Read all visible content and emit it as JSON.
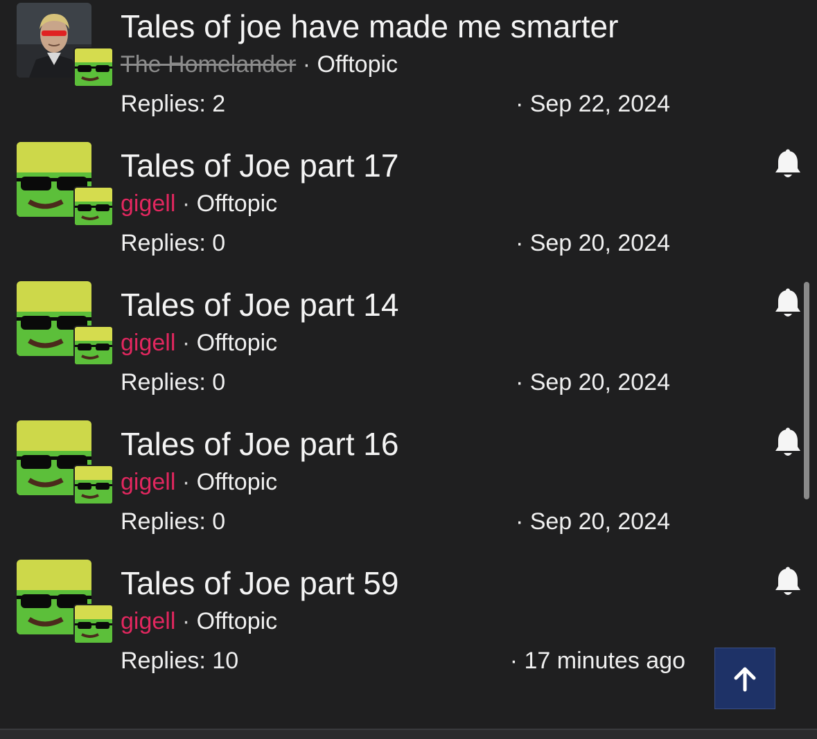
{
  "threads": [
    {
      "title": "Tales of joe have made me smarter",
      "author": "The Homelander",
      "author_style": "strikethrough",
      "separator": "·",
      "forum": "Offtopic",
      "replies": "Replies: 2",
      "date": "· Sep 22, 2024",
      "main_avatar": "man-with-red-glasses-avatar",
      "watched": false
    },
    {
      "title": "Tales of Joe part 17",
      "author": "gigell",
      "separator": "·",
      "forum": "Offtopic",
      "replies": "Replies: 0",
      "date": "· Sep 20, 2024",
      "main_avatar": "frog-with-sunglasses-avatar",
      "watched": true
    },
    {
      "title": "Tales of Joe part 14",
      "author": "gigell",
      "separator": "·",
      "forum": "Offtopic",
      "replies": "Replies: 0",
      "date": "· Sep 20, 2024",
      "main_avatar": "frog-with-sunglasses-avatar",
      "watched": true
    },
    {
      "title": "Tales of Joe part 16",
      "author": "gigell",
      "separator": "·",
      "forum": "Offtopic",
      "replies": "Replies: 0",
      "date": "· Sep 20, 2024",
      "main_avatar": "frog-with-sunglasses-avatar",
      "watched": true
    },
    {
      "title": "Tales of Joe part 59",
      "author": "gigell",
      "separator": "·",
      "forum": "Offtopic",
      "replies": "Replies: 10",
      "date": "· 17 minutes ago",
      "main_avatar": "frog-with-sunglasses-avatar",
      "watched": true
    }
  ],
  "icons": {
    "watch": "bell-icon",
    "scroll_top": "arrow-up-icon"
  },
  "colors": {
    "background": "#1f1f20",
    "author_link": "#e2275f",
    "scroll_top_button": "#1e3267"
  }
}
